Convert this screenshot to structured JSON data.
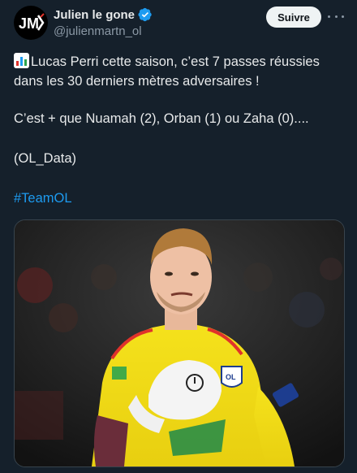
{
  "author": {
    "avatar_text": "JM",
    "name": "Julien le gone",
    "handle": "@julienmartn_ol",
    "verified": true
  },
  "actions": {
    "follow_label": "Suivre",
    "more_icon": "more-horizontal-icon"
  },
  "tweet": {
    "line1": "Lucas Perri cette saison, c’est 7 passes réussies",
    "line2": "dans les 30 derniers mètres adversaires !",
    "line3": "C’est + que Nuamah (2), Orban (1) ou Zaha (0)....",
    "line4": "(OL_Data)",
    "hashtag": "#TeamOL",
    "leading_icon": "bar-chart-icon"
  },
  "media": {
    "alt": "Goalkeeper in yellow jersey clenching fist"
  },
  "colors": {
    "background": "#15202b",
    "accent": "#1d9bf0",
    "verified": "#1d9bf0"
  }
}
